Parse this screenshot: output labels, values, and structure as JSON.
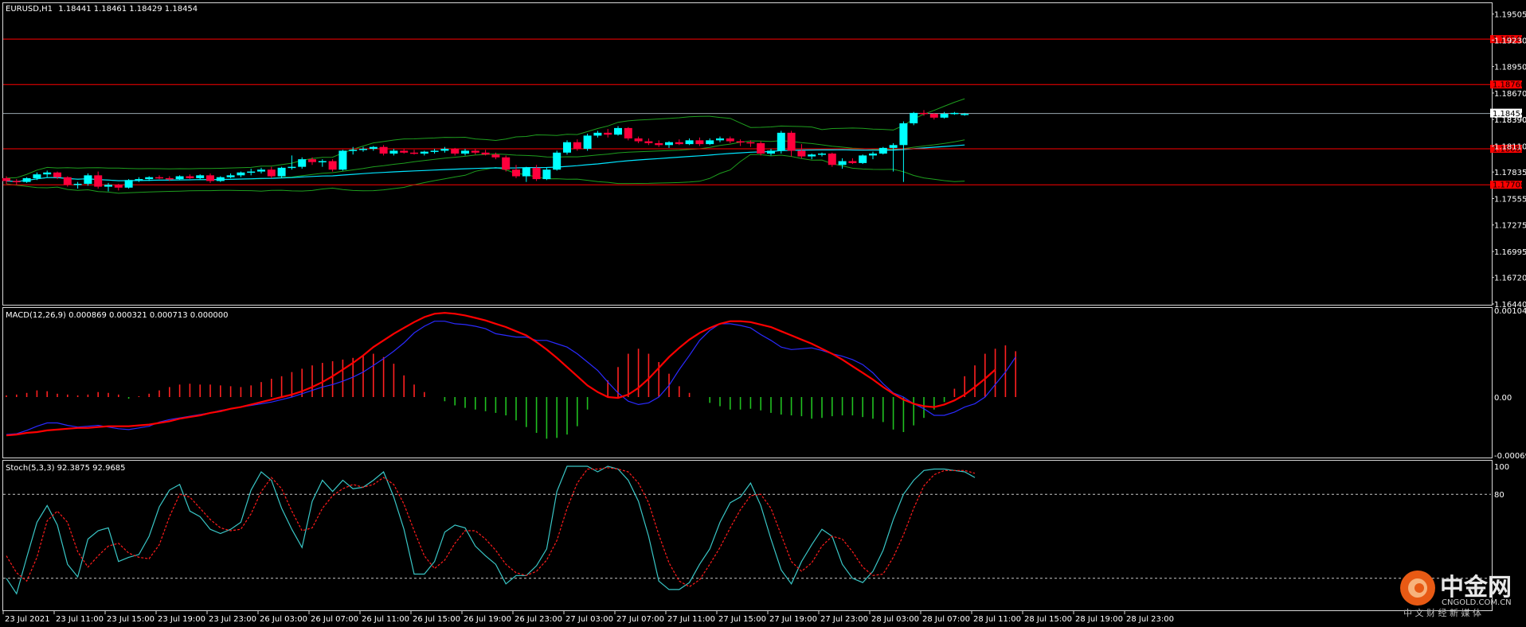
{
  "chart_data": [
    {
      "type": "candlestick",
      "panel": "price",
      "symbol_label": "EURUSD,H1",
      "ohlc_header": "1.18441 1.18461 1.18429 1.18454",
      "ylim": [
        1.1644,
        1.1962
      ],
      "y_ticks": [
        "1.19505",
        "1.19230",
        "1.18950",
        "1.18670",
        "1.18390",
        "1.18110",
        "1.17835",
        "1.17555",
        "1.17275",
        "1.16995",
        "1.16720",
        "1.16440"
      ],
      "y_tick_values": [
        1.19505,
        1.1923,
        1.1895,
        1.1867,
        1.1839,
        1.1811,
        1.17835,
        1.17555,
        1.17275,
        1.16995,
        1.1672,
        1.1644
      ],
      "current_price": {
        "value": 1.18454,
        "label": "1.18454"
      },
      "price_line_dup_label": "1.18390",
      "horizontal_levels": [
        {
          "value": 1.1924,
          "label": "1.19240",
          "color": "#ff0000"
        },
        {
          "value": 1.1876,
          "label": "1.18760",
          "color": "#ff0000"
        },
        {
          "value": 1.1808,
          "label": "1.18081",
          "color": "#ff0000"
        },
        {
          "value": 1.177,
          "label": "1.17708",
          "color": "#ff0000"
        }
      ],
      "bullish_color": "#00ffff",
      "bearish_color": "#ff003c",
      "bollinger_color": "#1e9e1e",
      "ma_color": "#00e5ff",
      "candles": [
        [
          1.1777,
          1.1779,
          1.1771,
          1.1774
        ],
        [
          1.1774,
          1.1776,
          1.177,
          1.1773
        ],
        [
          1.1773,
          1.1778,
          1.1772,
          1.1777
        ],
        [
          1.1777,
          1.1783,
          1.1775,
          1.1781
        ],
        [
          1.1781,
          1.1785,
          1.1778,
          1.1783
        ],
        [
          1.1783,
          1.1784,
          1.1776,
          1.1778
        ],
        [
          1.1778,
          1.1779,
          1.1768,
          1.177
        ],
        [
          1.177,
          1.1773,
          1.1766,
          1.1771
        ],
        [
          1.1771,
          1.1782,
          1.1769,
          1.178
        ],
        [
          1.178,
          1.1784,
          1.1766,
          1.1768
        ],
        [
          1.1768,
          1.1772,
          1.1763,
          1.177
        ],
        [
          1.177,
          1.1771,
          1.1764,
          1.1767
        ],
        [
          1.1767,
          1.1776,
          1.1766,
          1.1775
        ],
        [
          1.1775,
          1.1778,
          1.1773,
          1.1776
        ],
        [
          1.1776,
          1.1779,
          1.1774,
          1.1778
        ],
        [
          1.1778,
          1.178,
          1.1776,
          1.1777
        ],
        [
          1.1777,
          1.1779,
          1.1774,
          1.1776
        ],
        [
          1.1776,
          1.178,
          1.1775,
          1.1779
        ],
        [
          1.1779,
          1.1781,
          1.1776,
          1.1777
        ],
        [
          1.1777,
          1.1781,
          1.1776,
          1.178
        ],
        [
          1.178,
          1.1782,
          1.1772,
          1.1774
        ],
        [
          1.1774,
          1.1779,
          1.1773,
          1.1778
        ],
        [
          1.1778,
          1.1782,
          1.1777,
          1.178
        ],
        [
          1.178,
          1.1784,
          1.1778,
          1.1783
        ],
        [
          1.1783,
          1.1787,
          1.178,
          1.1784
        ],
        [
          1.1784,
          1.1788,
          1.1782,
          1.1786
        ],
        [
          1.1786,
          1.1789,
          1.1777,
          1.1779
        ],
        [
          1.1779,
          1.1789,
          1.1777,
          1.1788
        ],
        [
          1.1788,
          1.1801,
          1.1786,
          1.1789
        ],
        [
          1.1789,
          1.1799,
          1.1787,
          1.1797
        ],
        [
          1.1797,
          1.1799,
          1.1791,
          1.1794
        ],
        [
          1.1794,
          1.1797,
          1.1789,
          1.1795
        ],
        [
          1.1795,
          1.1797,
          1.1784,
          1.1786
        ],
        [
          1.1786,
          1.1807,
          1.1785,
          1.1806
        ],
        [
          1.1806,
          1.181,
          1.1802,
          1.1807
        ],
        [
          1.1807,
          1.181,
          1.1805,
          1.1808
        ],
        [
          1.1808,
          1.1811,
          1.1806,
          1.181
        ],
        [
          1.181,
          1.1812,
          1.1801,
          1.1803
        ],
        [
          1.1803,
          1.1808,
          1.1801,
          1.1806
        ],
        [
          1.1806,
          1.1808,
          1.1803,
          1.1804
        ],
        [
          1.1804,
          1.1807,
          1.1802,
          1.1803
        ],
        [
          1.1803,
          1.1806,
          1.1801,
          1.1805
        ],
        [
          1.1805,
          1.1808,
          1.1803,
          1.1806
        ],
        [
          1.1806,
          1.181,
          1.1804,
          1.1808
        ],
        [
          1.1808,
          1.1809,
          1.1801,
          1.1803
        ],
        [
          1.1803,
          1.1808,
          1.1801,
          1.1806
        ],
        [
          1.1806,
          1.1808,
          1.1802,
          1.1804
        ],
        [
          1.1804,
          1.1807,
          1.1801,
          1.1802
        ],
        [
          1.1802,
          1.1804,
          1.1797,
          1.1799
        ],
        [
          1.1799,
          1.1801,
          1.1784,
          1.1786
        ],
        [
          1.1786,
          1.1791,
          1.1777,
          1.1779
        ],
        [
          1.1779,
          1.1789,
          1.1773,
          1.1788
        ],
        [
          1.1788,
          1.1791,
          1.1774,
          1.1776
        ],
        [
          1.1776,
          1.1788,
          1.1775,
          1.1786
        ],
        [
          1.1786,
          1.1806,
          1.1785,
          1.1804
        ],
        [
          1.1804,
          1.1817,
          1.1802,
          1.1815
        ],
        [
          1.1815,
          1.1818,
          1.1806,
          1.1808
        ],
        [
          1.1808,
          1.1824,
          1.1806,
          1.1822
        ],
        [
          1.1822,
          1.1827,
          1.182,
          1.1825
        ],
        [
          1.1825,
          1.1829,
          1.182,
          1.1823
        ],
        [
          1.1823,
          1.1832,
          1.1822,
          1.183
        ],
        [
          1.183,
          1.1831,
          1.1817,
          1.1819
        ],
        [
          1.1819,
          1.1821,
          1.1814,
          1.1816
        ],
        [
          1.1816,
          1.1819,
          1.1812,
          1.1814
        ],
        [
          1.1814,
          1.1817,
          1.181,
          1.1812
        ],
        [
          1.1812,
          1.1816,
          1.1809,
          1.1815
        ],
        [
          1.1815,
          1.1818,
          1.1812,
          1.1813
        ],
        [
          1.1813,
          1.1819,
          1.1812,
          1.1817
        ],
        [
          1.1817,
          1.182,
          1.1811,
          1.1813
        ],
        [
          1.1813,
          1.1819,
          1.1812,
          1.1817
        ],
        [
          1.1817,
          1.1821,
          1.1815,
          1.1819
        ],
        [
          1.1819,
          1.1821,
          1.1814,
          1.1816
        ],
        [
          1.1816,
          1.1818,
          1.1811,
          1.1815
        ],
        [
          1.1815,
          1.1817,
          1.181,
          1.1814
        ],
        [
          1.1814,
          1.1816,
          1.1801,
          1.1803
        ],
        [
          1.1803,
          1.1808,
          1.1801,
          1.1806
        ],
        [
          1.1806,
          1.1827,
          1.1803,
          1.1825
        ],
        [
          1.1825,
          1.1827,
          1.18,
          1.1806
        ],
        [
          1.1806,
          1.1813,
          1.1798,
          1.18
        ],
        [
          1.18,
          1.1803,
          1.1797,
          1.1802
        ],
        [
          1.1802,
          1.1804,
          1.18,
          1.1803
        ],
        [
          1.1803,
          1.1804,
          1.1789,
          1.1791
        ],
        [
          1.1791,
          1.1798,
          1.1787,
          1.1795
        ],
        [
          1.1795,
          1.1798,
          1.1792,
          1.1793
        ],
        [
          1.1793,
          1.1802,
          1.1792,
          1.1801
        ],
        [
          1.1801,
          1.1805,
          1.1797,
          1.1803
        ],
        [
          1.1803,
          1.181,
          1.1802,
          1.1809
        ],
        [
          1.1809,
          1.1814,
          1.1784,
          1.1812
        ],
        [
          1.1812,
          1.1837,
          1.1773,
          1.1835
        ],
        [
          1.1835,
          1.1847,
          1.1833,
          1.1846
        ],
        [
          1.1846,
          1.1849,
          1.1843,
          1.1845
        ],
        [
          1.1845,
          1.1846,
          1.1839,
          1.1841
        ],
        [
          1.1841,
          1.1847,
          1.184,
          1.1845
        ],
        [
          1.1845,
          1.1847,
          1.1844,
          1.1846
        ],
        [
          1.1844,
          1.1846,
          1.1843,
          1.1845
        ]
      ],
      "x_tick_labels": [
        "23 Jul 2021",
        "23 Jul 11:00",
        "23 Jul 15:00",
        "23 Jul 19:00",
        "23 Jul 23:00",
        "26 Jul 03:00",
        "26 Jul 07:00",
        "26 Jul 11:00",
        "26 Jul 15:00",
        "26 Jul 19:00",
        "26 Jul 23:00",
        "27 Jul 03:00",
        "27 Jul 07:00",
        "27 Jul 11:00",
        "27 Jul 15:00",
        "27 Jul 19:00",
        "27 Jul 23:00",
        "28 Jul 03:00",
        "28 Jul 07:00",
        "28 Jul 11:00",
        "28 Jul 15:00",
        "28 Jul 19:00",
        "28 Jul 23:00"
      ]
    },
    {
      "type": "macd",
      "panel": "macd",
      "label": "MACD(12,26,9) 0.000869 0.000321 0.000713 0.000000",
      "y_ticks": [
        "0.001041",
        "0.00",
        "-0.000697"
      ],
      "y_tick_values": [
        0.001041,
        0.0,
        -0.000697
      ],
      "ylim": [
        -0.000697,
        0.001041
      ],
      "histogram_pos_color": "#ff2020",
      "histogram_neg_color": "#20c020",
      "main_line_color": "#2a2aff",
      "signal_line_color": "#ff0000",
      "histogram": [
        2e-05,
        3e-05,
        5e-05,
        8e-05,
        7e-05,
        4e-05,
        3e-05,
        2e-05,
        3e-05,
        6e-05,
        5e-05,
        3e-05,
        -2e-05,
        1e-05,
        4e-05,
        8e-05,
        0.00012,
        0.00015,
        0.00016,
        0.00015,
        0.00015,
        0.00014,
        0.00013,
        0.00012,
        0.00014,
        0.00018,
        0.00022,
        0.00025,
        0.0003,
        0.00034,
        0.00038,
        0.00041,
        0.00043,
        0.00045,
        0.00047,
        0.0005,
        0.00052,
        0.00048,
        0.0004,
        0.00026,
        0.00015,
        6e-05,
        0.0,
        -5e-05,
        -0.0001,
        -0.00013,
        -0.00015,
        -0.00017,
        -0.00019,
        -0.00022,
        -0.00028,
        -0.00036,
        -0.00043,
        -0.0005,
        -0.00049,
        -0.00045,
        -0.00035,
        -0.00015,
        0.0,
        0.0002,
        0.00036,
        0.00052,
        0.00058,
        0.00052,
        0.00042,
        0.00028,
        0.00013,
        5e-05,
        0.0,
        -7e-05,
        -0.00011,
        -0.00015,
        -0.00015,
        -0.00014,
        -0.00016,
        -0.00019,
        -0.00021,
        -0.00022,
        -0.00023,
        -0.00026,
        -0.00025,
        -0.00023,
        -0.00022,
        -0.00022,
        -0.00024,
        -0.00026,
        -0.0003,
        -0.00039,
        -0.00042,
        -0.00034,
        -0.00025,
        -0.00015,
        -6e-05,
        0.0001,
        0.00025,
        0.00038,
        0.00052,
        0.00058,
        0.00062,
        0.00055
      ],
      "main": [
        -0.00045,
        -0.00044,
        -0.0004,
        -0.00035,
        -0.00031,
        -0.00031,
        -0.00034,
        -0.00036,
        -0.00035,
        -0.00034,
        -0.00036,
        -0.00038,
        -0.00039,
        -0.00037,
        -0.00035,
        -0.0003,
        -0.00027,
        -0.00025,
        -0.00023,
        -0.00021,
        -0.00019,
        -0.00016,
        -0.00014,
        -0.00012,
        -0.0001,
        -8e-05,
        -6e-05,
        -3e-05,
        0.0,
        4e-05,
        8e-05,
        0.00012,
        0.00015,
        0.00019,
        0.00024,
        0.0003,
        0.00038,
        0.00046,
        0.00055,
        0.00065,
        0.00077,
        0.00085,
        0.00091,
        0.00091,
        0.00088,
        0.00087,
        0.00085,
        0.00082,
        0.00076,
        0.00074,
        0.00072,
        0.00072,
        0.00068,
        0.00068,
        0.00064,
        0.0006,
        0.00052,
        0.00042,
        0.00032,
        0.00018,
        5e-05,
        -5e-05,
        -9e-05,
        -7e-05,
        0.0,
        0.00014,
        0.00033,
        0.0005,
        0.00068,
        0.0008,
        0.00088,
        0.00088,
        0.00086,
        0.00083,
        0.00075,
        0.00068,
        0.0006,
        0.00057,
        0.00058,
        0.00059,
        0.00056,
        0.00052,
        0.00049,
        0.00045,
        0.00039,
        0.00029,
        0.00016,
        5e-05,
        -0.0,
        -8e-05,
        -0.00014,
        -0.00022,
        -0.00022,
        -0.00018,
        -0.00012,
        -8e-05,
        -0.0,
        0.00015,
        0.0003,
        0.00048
      ],
      "signal": [
        -0.00046,
        -0.00045,
        -0.00043,
        -0.00042,
        -0.0004,
        -0.00039,
        -0.00038,
        -0.00037,
        -0.00037,
        -0.00036,
        -0.00035,
        -0.00035,
        -0.00035,
        -0.00034,
        -0.00033,
        -0.00031,
        -0.00029,
        -0.00026,
        -0.00024,
        -0.00022,
        -0.00019,
        -0.00017,
        -0.00014,
        -0.00012,
        -9e-05,
        -6e-05,
        -3e-05,
        0.0,
        3e-05,
        7e-05,
        0.00012,
        0.00018,
        0.00025,
        0.00033,
        0.00041,
        0.0005,
        0.0006,
        0.00068,
        0.00076,
        0.00083,
        0.0009,
        0.00096,
        0.001,
        0.00101,
        0.001,
        0.00098,
        0.00095,
        0.00092,
        0.00088,
        0.00084,
        0.00079,
        0.00074,
        0.00066,
        0.00057,
        0.00047,
        0.00036,
        0.00025,
        0.00014,
        6e-05,
        0.0,
        -1e-05,
        3e-05,
        0.00011,
        0.00022,
        0.00035,
        0.00048,
        0.00059,
        0.00069,
        0.00077,
        0.00083,
        0.00088,
        0.00091,
        0.00091,
        0.0009,
        0.00087,
        0.00084,
        0.00079,
        0.00074,
        0.00069,
        0.00064,
        0.00058,
        0.00052,
        0.00045,
        0.00037,
        0.00029,
        0.00021,
        0.00012,
        4e-05,
        -3e-05,
        -8e-05,
        -0.00011,
        -0.00012,
        -9e-05,
        -4e-05,
        3e-05,
        0.00012,
        0.00022,
        0.00033
      ],
      "flat_red_line": [
        -0.00046,
        -0.00045,
        -0.00044,
        -0.00043,
        -0.00042,
        -0.00041,
        -0.0004,
        -0.0004,
        -0.00039,
        -0.00038
      ]
    },
    {
      "type": "line",
      "panel": "stochastic",
      "label": "Stoch(5,3,3) 92.3875 92.9685",
      "y_ticks": [
        "100",
        "80"
      ],
      "y_tick_values": [
        100,
        80
      ],
      "ylim": [
        0,
        100
      ],
      "levels": [
        80,
        20
      ],
      "main_color": "#39c6c6",
      "signal_color": "#ff1c1c",
      "main": [
        20,
        9,
        35,
        60,
        72,
        58,
        30,
        21,
        48,
        54,
        56,
        32,
        35,
        37,
        50,
        71,
        83,
        87,
        68,
        64,
        55,
        52,
        55,
        60,
        83,
        96,
        90,
        70,
        55,
        42,
        75,
        90,
        82,
        90,
        84,
        85,
        90,
        96,
        78,
        55,
        23,
        23,
        32,
        53,
        58,
        56,
        43,
        36,
        30,
        16,
        22,
        22,
        29,
        41,
        82,
        100,
        100,
        100,
        96,
        100,
        98,
        90,
        75,
        50,
        18,
        12,
        12,
        17,
        30,
        41,
        60,
        74,
        78,
        88,
        72,
        48,
        26,
        16,
        32,
        44,
        55,
        50,
        30,
        20,
        17,
        25,
        40,
        62,
        80,
        90,
        97,
        98,
        98,
        97,
        96,
        92
      ],
      "signal": [
        36,
        24,
        18,
        35,
        61,
        68,
        60,
        39,
        28,
        36,
        43,
        45,
        38,
        35,
        34,
        44,
        64,
        80,
        78,
        70,
        62,
        56,
        54,
        55,
        66,
        82,
        92,
        84,
        68,
        54,
        56,
        70,
        79,
        84,
        87,
        85,
        87,
        92,
        87,
        73,
        54,
        36,
        27,
        33,
        45,
        54,
        54,
        48,
        40,
        30,
        24,
        22,
        25,
        33,
        47,
        70,
        88,
        98,
        98,
        99,
        98,
        96,
        88,
        74,
        51,
        31,
        18,
        14,
        19,
        30,
        42,
        56,
        69,
        79,
        80,
        70,
        51,
        32,
        25,
        31,
        43,
        50,
        48,
        39,
        28,
        22,
        23,
        35,
        51,
        70,
        86,
        94,
        97,
        97,
        97,
        95
      ]
    }
  ],
  "logo": {
    "name": "中金网",
    "domain": "CNGOLD.COM.CN",
    "tagline": "中 文 财 经 新 媒 体"
  }
}
